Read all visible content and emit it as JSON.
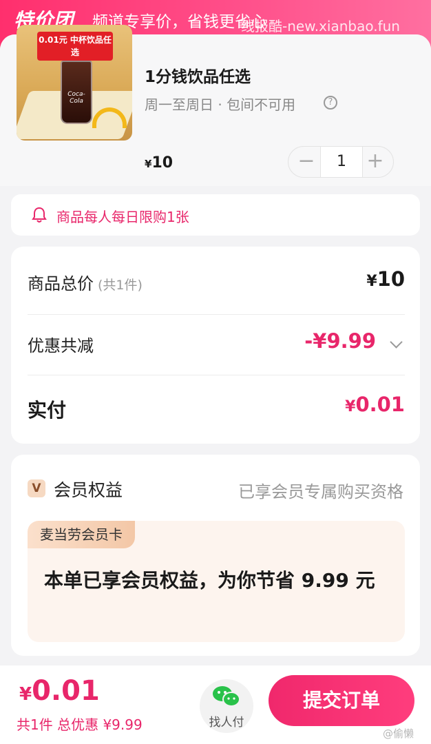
{
  "banner": {
    "logo": "特价团",
    "slogan": "频道专享价，省钱更省心",
    "watermark": "线报酷-new.xianbao.fun"
  },
  "product": {
    "image_banner": "0.01元 中杯饮品任选",
    "image_label": "Coca-Cola",
    "title": "1分钱饮品任选",
    "subtitle": "周一至周日 · 包间不可用",
    "help_symbol": "?",
    "currency": "¥",
    "price": "10",
    "quantity": "1",
    "minus_symbol": "−",
    "plus_symbol": "+"
  },
  "notice": {
    "icon": "bell-icon",
    "text": "商品每人每日限购1张"
  },
  "summary": {
    "total_label": "商品总价",
    "total_count": "(共1件)",
    "total_currency": "¥",
    "total_value": "10",
    "discount_label": "优惠共减",
    "discount_value": "-¥9.99",
    "pay_label": "实付",
    "pay_currency": "¥",
    "pay_value": "0.01"
  },
  "member": {
    "badge": "V",
    "title": "会员权益",
    "status": "已享会员专属购买资格",
    "tag": "麦当劳会员卡",
    "save_text": "本单已享会员权益，为你节省 9.99 元"
  },
  "bottom": {
    "currency": "¥",
    "total": "0.01",
    "sub": "共1件 总优惠 ¥9.99",
    "friend_pay_label": "找人付",
    "submit_label": "提交订单",
    "watermark": "@偷懒"
  },
  "colors": {
    "accent": "#e8266a",
    "banner_start": "#ff2f6d",
    "banner_end": "#ff6fa0"
  }
}
